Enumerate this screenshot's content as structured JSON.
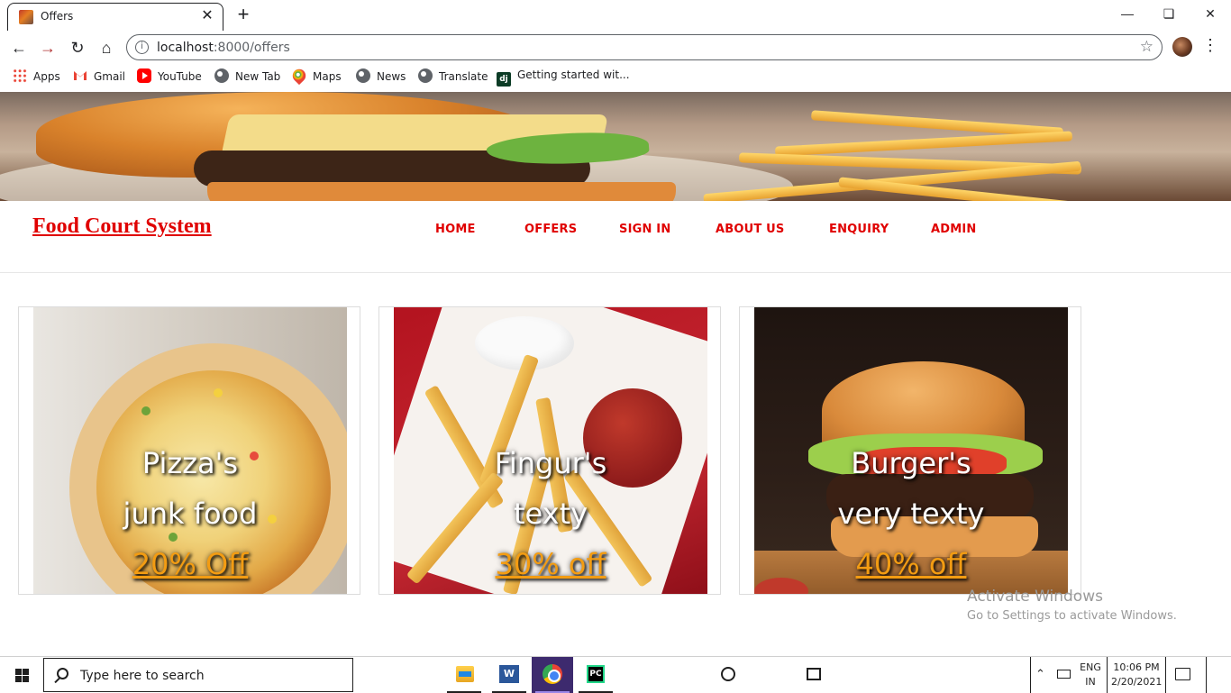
{
  "browser": {
    "tab_title": "Offers",
    "url_host": "localhost",
    "url_path": ":8000/offers",
    "bookmarks": [
      "Apps",
      "Gmail",
      "YouTube",
      "New Tab",
      "Maps",
      "News",
      "Translate",
      "Getting started wit..."
    ]
  },
  "site": {
    "brand": "Food Court System",
    "nav": [
      "HOME",
      "OFFERS",
      "SIGN IN",
      "ABOUT US",
      "ENQUIRY",
      "ADMIN"
    ]
  },
  "offers": [
    {
      "line1": "Pizza's",
      "line2": "junk food",
      "discount": "20% Off"
    },
    {
      "line1": "Fingur's",
      "line2": "texty",
      "discount": "30% off"
    },
    {
      "line1": "Burger's",
      "line2": "very texty",
      "discount": "40% off"
    }
  ],
  "watermark": {
    "title": "Activate Windows",
    "subtitle": "Go to Settings to activate Windows."
  },
  "taskbar": {
    "search_placeholder": "Type here to search",
    "lang_top": "ENG",
    "lang_bottom": "IN",
    "time": "10:06 PM",
    "date": "2/20/2021"
  },
  "colors": {
    "brand_red": "#e00000",
    "offer_orange": "#f39c12"
  }
}
